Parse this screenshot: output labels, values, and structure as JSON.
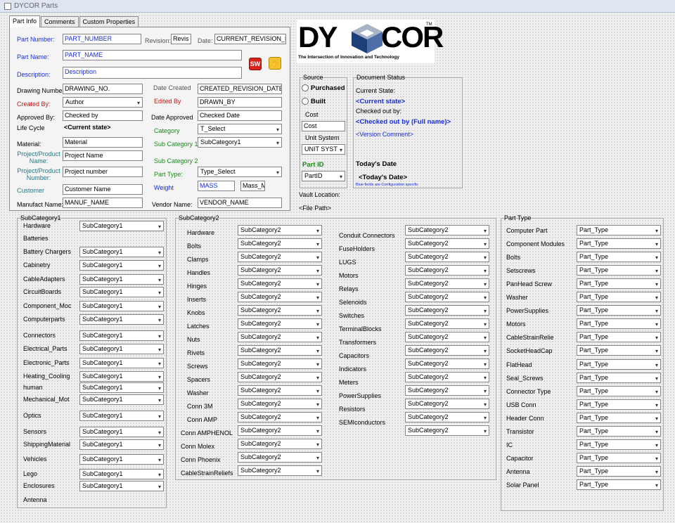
{
  "window": {
    "title": "DYCOR Parts"
  },
  "tabs": [
    "Part Info",
    "Comments",
    "Custom Properties"
  ],
  "part_info": {
    "part_number": {
      "label": "Part Number:",
      "value": "PART_NUMBER"
    },
    "revision": {
      "label": "Revision:",
      "value": "Revis"
    },
    "date": {
      "label": "Date:",
      "value": "CURRENT_REVISION_D"
    },
    "part_name": {
      "label": "Part Name:",
      "value": "PART_NAME"
    },
    "description": {
      "label": "Description:",
      "value": "Description"
    },
    "drawing_number": {
      "label": "Drawing Number:",
      "value": "DRAWING_NO."
    },
    "date_created": {
      "label": "Date Created",
      "value": "CREATED_REVISION_DATE"
    },
    "created_by": {
      "label": "Created By:",
      "value": "Author"
    },
    "edited_by": {
      "label": "Edited By",
      "value": "DRAWN_BY"
    },
    "approved_by": {
      "label": "Approved By:",
      "value": "Checked by"
    },
    "date_approved": {
      "label": "Date Approved",
      "value": "Checked Date"
    },
    "life_cycle": {
      "label": "Life Cycle",
      "value": "<Current state>"
    },
    "category": {
      "label": "Category",
      "value": "T_Select"
    },
    "material": {
      "label": "Material:",
      "value": "Material"
    },
    "sub_category_1": {
      "label": "Sub Category 1",
      "value": "SubCategory1"
    },
    "project_name": {
      "label": "Project/Product Name:",
      "value": "Project Name"
    },
    "sub_category_2": {
      "label": "Sub Category 2"
    },
    "project_number": {
      "label": "Project/Product Number:",
      "value": "Project number"
    },
    "part_type": {
      "label": "Part Type:",
      "value": "Type_Select"
    },
    "customer": {
      "label": "Customer",
      "value": "Customer Name"
    },
    "weight": {
      "label": "Weight",
      "value": "MASS",
      "unit": "Mass_M"
    },
    "manufact_name": {
      "label": "Manufact Name:",
      "value": "MANUF_NAME"
    },
    "vendor_name": {
      "label": "Vendor Name:",
      "value": "VENDOR_NAME"
    }
  },
  "logo": {
    "brand_left": "DY",
    "brand_right": "COR",
    "tm": "TM",
    "tagline": "The Intersection of Innovation and Technology"
  },
  "source": {
    "label": "Source",
    "options": [
      "Purchased",
      "Built"
    ],
    "cost_label": "Cost",
    "cost_value": "Cost",
    "unit_label": "Unit System",
    "unit_value": "UNIT SYST",
    "part_id_label": "Part ID",
    "part_id_value": "PartID"
  },
  "doc_status": {
    "label": "Document Status",
    "current_state_label": "Current State:",
    "current_state": "<Current state>",
    "checked_out_label": "Checked out by:",
    "checked_out": "<Checked out by (Full name)>",
    "version_comment": "<Version Comment>",
    "today_label": "Today's Date",
    "today": "<Today's Date>",
    "note": "Blue fields are Configuration specific"
  },
  "vault": {
    "label": "Vault Location:",
    "path": "<File Path>"
  },
  "subcategory1": {
    "title": "SubCategory1",
    "dropdown": "SubCategory1",
    "rows": [
      {
        "name": "Hardware",
        "dd": true
      },
      {
        "name": "Batteries",
        "dd": false
      },
      {
        "name": "Battery Chargers",
        "dd": true
      },
      {
        "name": "Cabinetry",
        "dd": true
      },
      {
        "name": "CableAdapters",
        "dd": true
      },
      {
        "name": "CircuitBoards",
        "dd": true
      },
      {
        "name": "Component_Moc",
        "dd": true
      },
      {
        "name": "Computerparts",
        "dd": true
      },
      {
        "name": "Connectors",
        "dd": true
      },
      {
        "name": "Electrical_Parts",
        "dd": true
      },
      {
        "name": "Electronic_Parts",
        "dd": true
      },
      {
        "name": "Heating_Cooling",
        "dd": true
      },
      {
        "name": "human",
        "dd": true
      },
      {
        "name": "Mechanical_Mot",
        "dd": true
      },
      {
        "name": "Optics",
        "dd": true
      },
      {
        "name": "Sensors",
        "dd": true
      },
      {
        "name": "ShippingMaterial",
        "dd": true
      },
      {
        "name": "Vehicles",
        "dd": true
      },
      {
        "name": "Lego",
        "dd": true
      },
      {
        "name": "Enclosures",
        "dd": true
      },
      {
        "name": "Antenna",
        "dd": false
      }
    ]
  },
  "subcategory2": {
    "title": "SubCategory2",
    "dropdown": "SubCategory2",
    "col1": [
      "Hardware",
      "Bolts",
      "Clamps",
      "Handles",
      "Hinges",
      "Inserts",
      "Knobs",
      "Latches",
      "Nuts",
      "Rivets",
      "Screws",
      "Spacers",
      "Washer",
      "Conn 3M",
      "Conn AMP",
      "Conn AMPHENOL",
      "Conn Molex",
      "Conn Phoenix",
      "CableStrainReliefs"
    ],
    "col2": [
      "Conduit Connectors",
      "FuseHolders",
      "LUGS",
      "Motors",
      "Relays",
      "Selenoids",
      "Switches",
      "TerminalBlocks",
      "Transformers",
      "Capacitors",
      "Indicators",
      "Meters",
      "PowerSupplies",
      "Resistors",
      "SEMIconductors",
      ""
    ]
  },
  "part_type": {
    "title": "Part Type",
    "dropdown": "Part_Type",
    "rows": [
      "Computer Part",
      "Component Modules",
      "Bolts",
      "Setscrews",
      "PanHead Screw",
      "Washer",
      "PowerSupplies",
      "Motors",
      "CableStrainRelie",
      "SocketHeadCap",
      "FlatHead",
      "Seal_Screws",
      "Connector Type",
      "USB Conn",
      "Header Conn",
      "Transistor",
      "IC",
      "Capacitor",
      "Antenna",
      "Solar Panel"
    ]
  }
}
